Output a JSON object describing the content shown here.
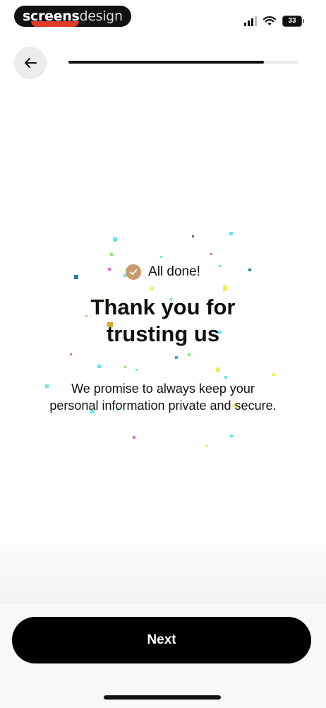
{
  "status_bar": {
    "watermark_part1": "screens",
    "watermark_part2": "design",
    "battery": "33"
  },
  "header": {
    "back_icon": "arrow-left-icon",
    "progress_fraction": 0.85
  },
  "content": {
    "done_label": "All done!",
    "check_icon": "check-icon",
    "title_line1": "Thank you for",
    "title_line2": "trusting us",
    "subtitle_line1": "We promise to always keep your",
    "subtitle_line2": "personal information private and secure."
  },
  "footer": {
    "next_label": "Next"
  },
  "colors": {
    "accent_check": "#c99a6c",
    "button_bg": "#000000",
    "progress_fill": "#111111"
  }
}
